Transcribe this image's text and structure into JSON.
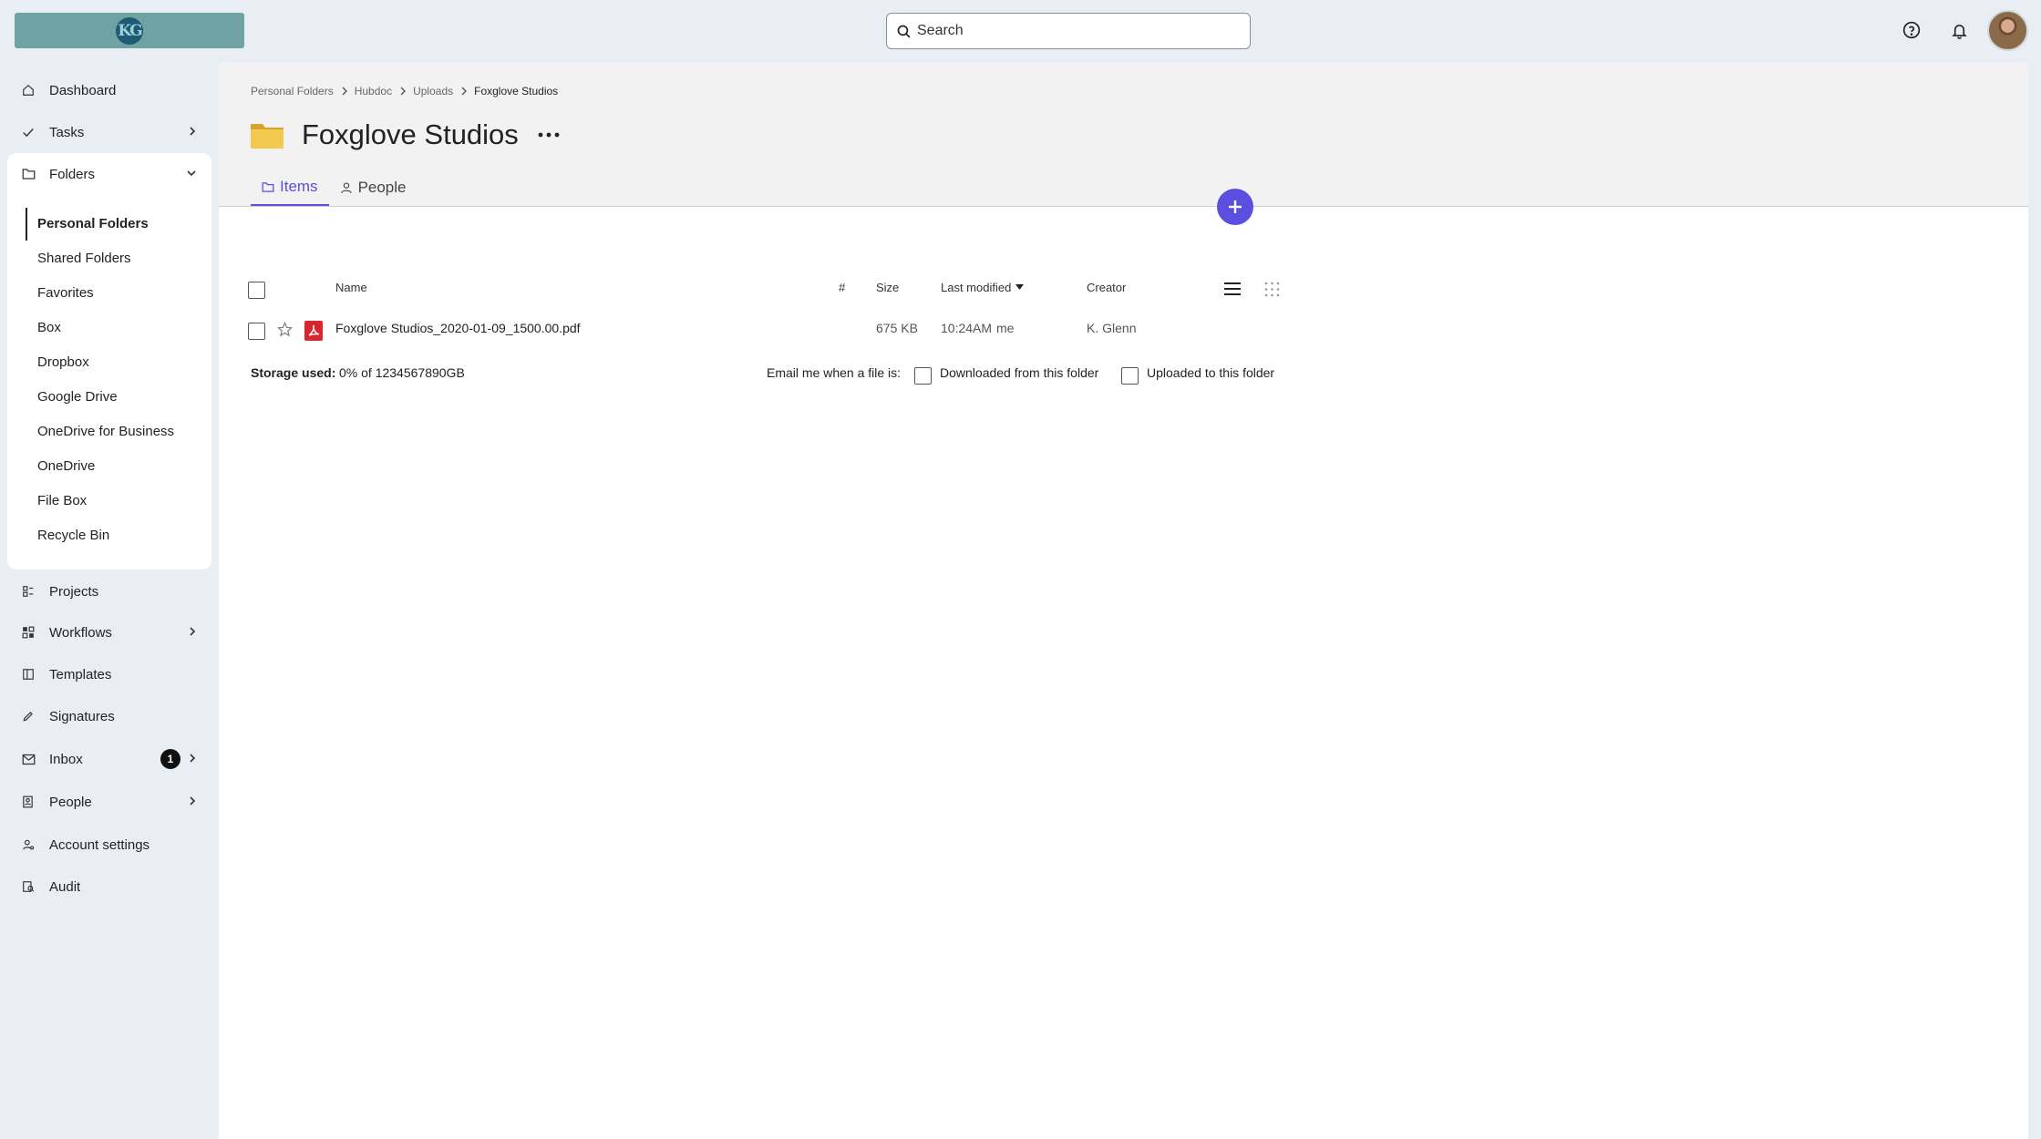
{
  "header": {
    "logo_text": "KG",
    "search_placeholder": "Search"
  },
  "sidebar": {
    "items": [
      {
        "label": "Dashboard",
        "icon": "home-icon"
      },
      {
        "label": "Tasks",
        "icon": "check-icon"
      },
      {
        "label": "Folders",
        "icon": "folder-icon"
      },
      {
        "label": "Projects",
        "icon": "projects-icon"
      },
      {
        "label": "Workflows",
        "icon": "workflow-icon"
      },
      {
        "label": "Templates",
        "icon": "template-icon"
      },
      {
        "label": "Signatures",
        "icon": "pen-icon"
      },
      {
        "label": "Inbox",
        "icon": "mail-icon",
        "badge": "1"
      },
      {
        "label": "People",
        "icon": "people-icon"
      },
      {
        "label": "Account settings",
        "icon": "account-icon"
      },
      {
        "label": "Audit",
        "icon": "audit-icon"
      }
    ],
    "folders": [
      "Personal Folders",
      "Shared Folders",
      "Favorites",
      "Box",
      "Dropbox",
      "Google Drive",
      "OneDrive for Business",
      "OneDrive",
      "File Box",
      "Recycle Bin"
    ],
    "active_folder": "Personal Folders"
  },
  "main": {
    "breadcrumb": [
      "Personal Folders",
      "Hubdoc",
      "Uploads",
      "Foxglove Studios"
    ],
    "title": "Foxglove Studios",
    "tabs": [
      {
        "label": "Items",
        "active": true
      },
      {
        "label": "People",
        "active": false
      }
    ],
    "table": {
      "headers": {
        "name": "Name",
        "num": "#",
        "size": "Size",
        "modified": "Last modified",
        "creator": "Creator"
      },
      "rows": [
        {
          "name": "Foxglove Studios_2020-01-09_1500.00.pdf",
          "size": "675 KB",
          "modified": "10:24AM",
          "modified_by": "me",
          "creator": "K. Glenn"
        }
      ]
    },
    "storage": {
      "label": "Storage used:",
      "value": "0% of 1234567890GB"
    },
    "email": {
      "label": "Email me when a file is:",
      "option_downloaded": "Downloaded from this folder",
      "option_uploaded": "Uploaded to this folder"
    }
  },
  "colors": {
    "accent": "#5b4fe0",
    "logo_bg": "#6fa3a3",
    "pdf_red": "#d8262f"
  }
}
